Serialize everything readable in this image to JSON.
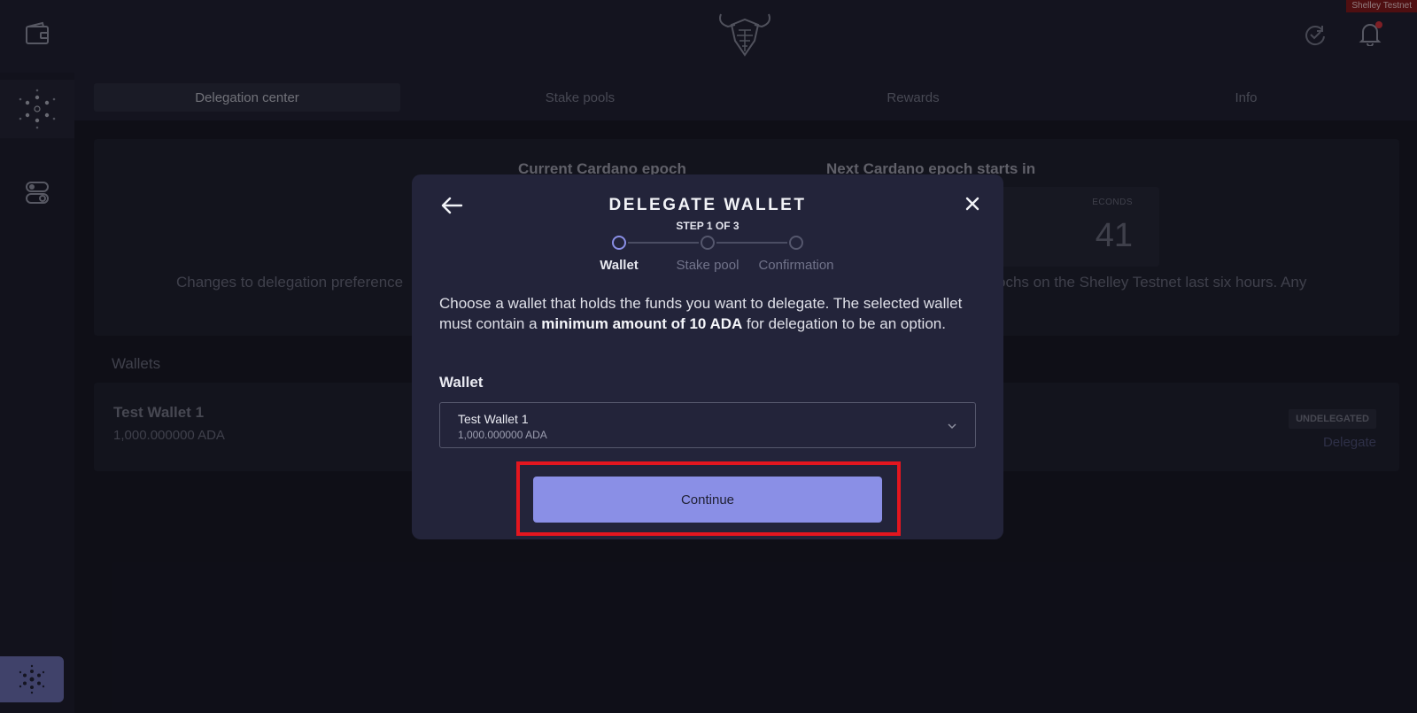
{
  "top_bar": {
    "network_badge": "Shelley Testnet"
  },
  "tabs": [
    {
      "label": "Delegation center"
    },
    {
      "label": "Stake pools"
    },
    {
      "label": "Rewards"
    },
    {
      "label": "Info"
    }
  ],
  "epoch": {
    "current_title": "Current Cardano epoch",
    "next_title": "Next Cardano epoch starts in",
    "countdown_unit": "ECONDS",
    "countdown_value": "41",
    "note_left": "Changes to delegation preference",
    "note_right": "ochs on the Shelley Testnet last six hours. Any"
  },
  "wallets_section": {
    "heading": "Wallets",
    "rows": [
      {
        "name": "Test Wallet 1",
        "amount": "1,000.000000 ADA",
        "status": "UNDELEGATED",
        "action": "Delegate"
      }
    ]
  },
  "modal": {
    "title": "DELEGATE WALLET",
    "step_text": "STEP 1 OF 3",
    "steps": [
      {
        "label": "Wallet",
        "active": true
      },
      {
        "label": "Stake pool",
        "active": false
      },
      {
        "label": "Confirmation",
        "active": false
      }
    ],
    "description_pre": "Choose a wallet that holds the funds you want to delegate. The selected wallet must contain a ",
    "description_bold": "minimum amount of 10 ADA",
    "description_post": " for delegation to be an option.",
    "wallet_label": "Wallet",
    "selected_wallet": {
      "name": "Test Wallet 1",
      "amount": "1,000.000000 ADA"
    },
    "continue_label": "Continue"
  },
  "colors": {
    "accent": "#8a8fe6",
    "highlight": "#e3161f",
    "badge": "#8b1616"
  }
}
